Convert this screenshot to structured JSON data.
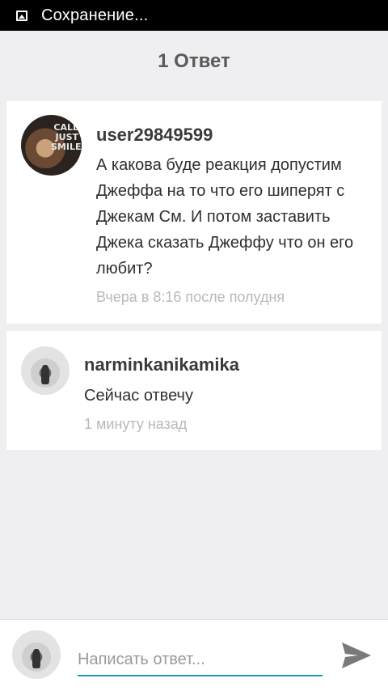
{
  "status_bar": {
    "icon": "image-icon",
    "text": "Сохранение..."
  },
  "header": {
    "title": "1 Ответ"
  },
  "comments": [
    {
      "username": "user29849599",
      "avatar_text": "CALL ME JUST SMILE",
      "text": "А какова буде реакция допустим Джеффа на то что его шиперят с Джекам См. И потом заставить Джека сказать Джеффу что он его любит?",
      "timestamp": "Вчера в 8:16 после полудня"
    },
    {
      "username": "narminkanikamika",
      "text": "Сейчас отвечу",
      "timestamp": "1 минуту назад"
    }
  ],
  "reply": {
    "placeholder": "Написать ответ...",
    "send_icon": "send-icon",
    "accent_color": "#2196b8"
  }
}
